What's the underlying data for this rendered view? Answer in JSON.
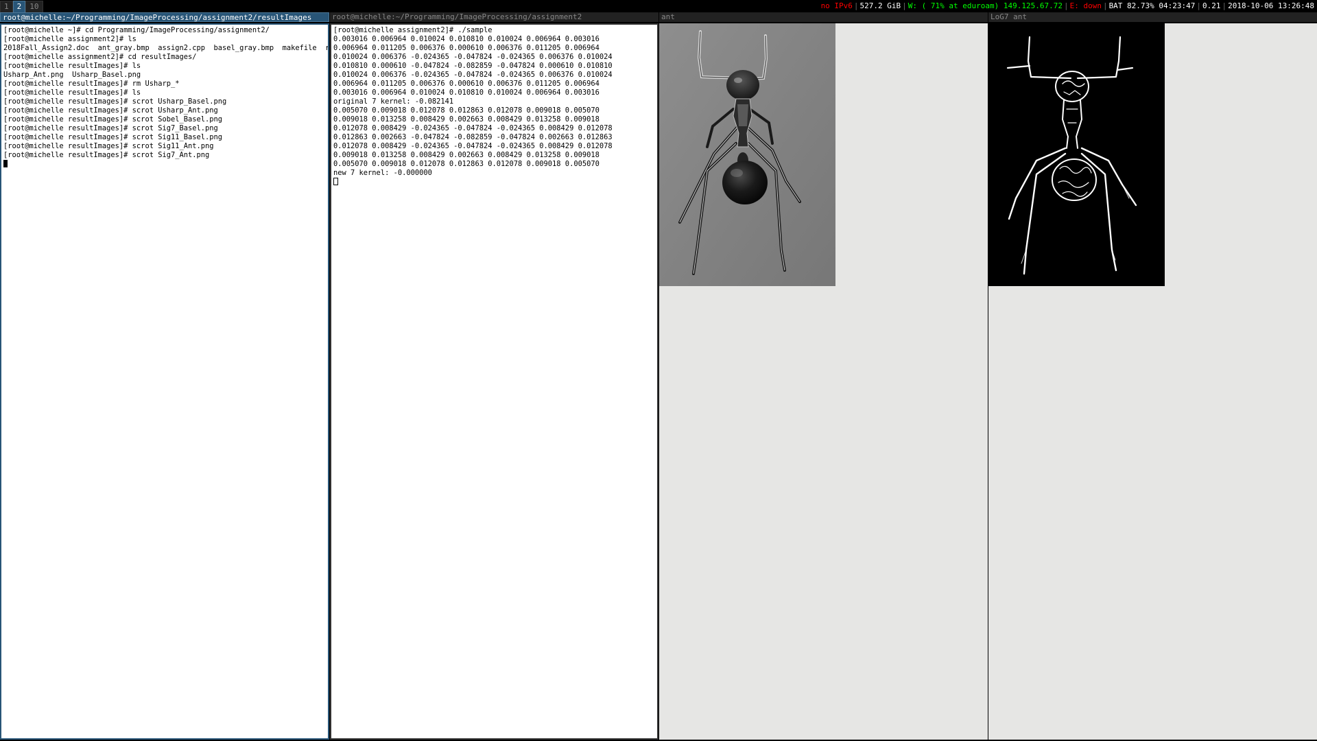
{
  "bar": {
    "workspaces": [
      {
        "label": "1",
        "focused": false
      },
      {
        "label": "2",
        "focused": true
      },
      {
        "label": "10",
        "focused": false
      }
    ],
    "status": {
      "ipv6": "no IPv6",
      "disk": "527.2 GiB",
      "wifi": "W: ( 71% at eduroam) 149.125.67.72",
      "ethernet": "E: down",
      "battery": "BAT 82.73% 04:23:47",
      "load": "0.21",
      "datetime": "2018-10-06 13:26:48"
    },
    "colors": {
      "focused": "#285577",
      "bad": "#ff0000",
      "good": "#00ff00"
    }
  },
  "windows": {
    "term1": {
      "title": "root@michelle:~/Programming/ImageProcessing/assignment2/resultImages",
      "focused": true,
      "lines": [
        "[root@michelle ~]# cd Programming/ImageProcessing/assignment2/",
        "[root@michelle assignment2]# ls",
        "2018Fall_Assign2.doc  ant_gray.bmp  assign2.cpp  basel_gray.bmp  makefile  res",
        "[root@michelle assignment2]# cd resultImages/",
        "[root@michelle resultImages]# ls",
        "Usharp_Ant.png  Usharp_Basel.png",
        "[root@michelle resultImages]# rm Usharp_*",
        "[root@michelle resultImages]# ls",
        "[root@michelle resultImages]# scrot Usharp_Basel.png",
        "[root@michelle resultImages]# scrot Usharp_Ant.png",
        "[root@michelle resultImages]# scrot Sobel_Basel.png",
        "[root@michelle resultImages]# scrot Sig7_Basel.png",
        "[root@michelle resultImages]# scrot Sig11_Basel.png",
        "[root@michelle resultImages]# scrot Sig11_Ant.png",
        "[root@michelle resultImages]# scrot Sig7_Ant.png"
      ]
    },
    "term2": {
      "title": "root@michelle:~/Programming/ImageProcessing/assignment2",
      "focused": false,
      "lines": [
        "[root@michelle assignment2]# ./sample",
        "0.003016 0.006964 0.010024 0.010810 0.010024 0.006964 0.003016",
        "0.006964 0.011205 0.006376 0.000610 0.006376 0.011205 0.006964",
        "0.010024 0.006376 -0.024365 -0.047824 -0.024365 0.006376 0.010024",
        "0.010810 0.000610 -0.047824 -0.082859 -0.047824 0.000610 0.010810",
        "0.010024 0.006376 -0.024365 -0.047824 -0.024365 0.006376 0.010024",
        "0.006964 0.011205 0.006376 0.000610 0.006376 0.011205 0.006964",
        "0.003016 0.006964 0.010024 0.010810 0.010024 0.006964 0.003016",
        "original 7 kernel: -0.082141",
        "0.005070 0.009018 0.012078 0.012863 0.012078 0.009018 0.005070",
        "0.009018 0.013258 0.008429 0.002663 0.008429 0.013258 0.009018",
        "0.012078 0.008429 -0.024365 -0.047824 -0.024365 0.008429 0.012078",
        "0.012863 0.002663 -0.047824 -0.082859 -0.047824 0.002663 0.012863",
        "0.012078 0.008429 -0.024365 -0.047824 -0.024365 0.008429 0.012078",
        "0.009018 0.013258 0.008429 0.002663 0.008429 0.013258 0.009018",
        "0.005070 0.009018 0.012078 0.012863 0.012078 0.009018 0.005070",
        "new 7 kernel: -0.000000"
      ]
    },
    "viewer1": {
      "title": "ant",
      "image": "grayscale photo of an ant"
    },
    "viewer2": {
      "title": "LoG7 ant",
      "image": "binary edge map of an ant"
    }
  }
}
